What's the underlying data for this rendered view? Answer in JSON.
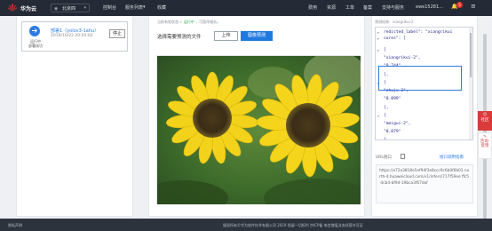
{
  "topbar": {
    "brand": "华为云",
    "region": "北京四",
    "nav_left": [
      "控制台",
      "服务列表",
      "收藏"
    ],
    "nav_right": [
      "费用",
      "资源",
      "工单",
      "备案",
      "支持与服务",
      "ewe15281..."
    ],
    "notification_count": "5"
  },
  "task": {
    "status": "运行中\n部署成功",
    "name": "部署1（yolov3-1ahu）",
    "time": "2019/10/22 20:05:02",
    "stop_label": "停止"
  },
  "main": {
    "hint_prefix": "当前有效状态",
    "hint_ok": "✓ 运行中",
    "hint_suffix": "，可暂停服务。",
    "upload_label": "选择需要预测的文件",
    "upload_button": "上传",
    "predict_button": "图像预测"
  },
  "result": {
    "label": "预测结果：xiangrikui-2",
    "code_lines": [
      "redicted_label\": \"xiangrikui",
      "cores\": [",
      "[",
      "  \"xiangrikui-2\",",
      "  \"0.744\"",
      "],",
      "[",
      "  \"zhuju-2\",",
      "  \"0.099\"",
      "],",
      "[",
      "  \"meigui-2\",",
      "  \"0.079\"",
      "],",
      "["
    ],
    "url_label": "URL接口",
    "api_link": "接口调用指南",
    "url_value": "https://a72a3818e5ef94f3e8ccc9c6b0f6b03 north-4.huaweicloud.com/v1/infers/717f59ee ffc5-4cb4-bf9d-19bca3f67daf"
  },
  "side_tabs": [
    "社区",
    "咨询·反馈"
  ],
  "footer": {
    "left": "隐私声明",
    "right": "版权所有©华为软件技术有限公司 2019 保留一切权利    京ICP备    电信增值业务经营许可证"
  },
  "colors": {
    "topbar": "#252b36",
    "accent": "#1f7ae0",
    "success": "#2aa44f",
    "alert": "#d93a3a"
  }
}
